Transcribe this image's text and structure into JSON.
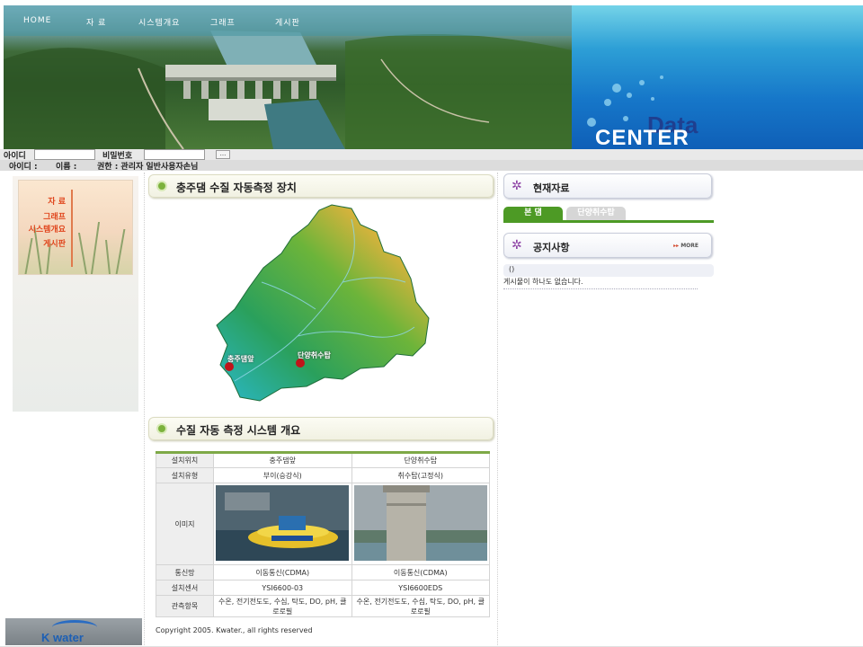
{
  "nav": {
    "items": [
      "HOME",
      "자 료",
      "시스템개요",
      "그래프",
      "게시판"
    ]
  },
  "banner": {
    "title_small": "Data",
    "title_large": "CENTER"
  },
  "login": {
    "id_label": "아이디",
    "password_label": "비밀번호",
    "id_value": "",
    "password_value": "",
    "submit_label": "..."
  },
  "user_info": {
    "id_label": "아이디 :",
    "name_label": "이름 :",
    "role_label": "권한 : 관리자 일반사용자손님"
  },
  "sidebar": {
    "items": [
      "자 료",
      "그래프",
      "시스템개요",
      "게시판"
    ]
  },
  "main": {
    "section1_title": "충주댐 수질 자동측정 장치",
    "map_labels": {
      "site1": "충주댐앞",
      "site2": "단양취수탑"
    },
    "section2_title": "수질 자동 측정 시스템 개요",
    "table": {
      "rows": [
        {
          "header": "설치위치",
          "col1": "충주댐앞",
          "col2": "단양취수탑"
        },
        {
          "header": "설치유형",
          "col1": "부이(승강식)",
          "col2": "취수탑(고정식)"
        },
        {
          "header": "이미지",
          "col1": "",
          "col2": ""
        },
        {
          "header": "통신망",
          "col1": "이동통신(CDMA)",
          "col2": "이동통신(CDMA)"
        },
        {
          "header": "설치센서",
          "col1": "YSI6600-03",
          "col2": "YSI6600EDS"
        },
        {
          "header": "관측항목",
          "col1": "수온, 전기전도도, 수심, 탁도, DO, pH, 클로로필",
          "col2": "수온, 전기전도도, 수심, 탁도, DO, pH, 클로로필"
        }
      ]
    },
    "copyright": "Copyright 2005. Kwater., all rights reserved"
  },
  "right": {
    "current_title": "현재자료",
    "tabs": [
      "본 댐",
      "단양취수탑"
    ],
    "notice_title": "공지사항",
    "more_label": "MORE",
    "notice_paren": "()",
    "notice_empty": "게시물이 하나도 없습니다."
  },
  "footer_logo": "K water",
  "colors": {
    "accent_green": "#4d9a25",
    "menu_orange": "#e0461d",
    "banner_blue": "#1677c9"
  }
}
